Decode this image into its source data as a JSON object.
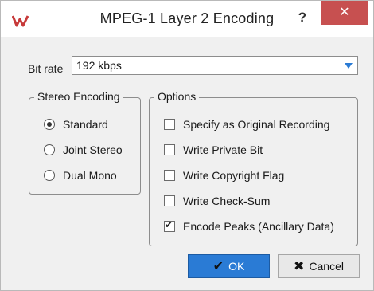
{
  "window": {
    "title": "MPEG-1 Layer 2 Encoding",
    "help_label": "?",
    "close_label": "✕",
    "app_icon": "app-icon"
  },
  "bitrate": {
    "label": "Bit rate",
    "value": "192 kbps"
  },
  "stereo": {
    "title": "Stereo Encoding",
    "options": [
      {
        "label": "Standard",
        "checked": true
      },
      {
        "label": "Joint Stereo",
        "checked": false
      },
      {
        "label": "Dual Mono",
        "checked": false
      }
    ]
  },
  "options": {
    "title": "Options",
    "items": [
      {
        "label": "Specify as Original Recording",
        "checked": false
      },
      {
        "label": "Write Private Bit",
        "checked": false
      },
      {
        "label": "Write Copyright Flag",
        "checked": false
      },
      {
        "label": "Write Check-Sum",
        "checked": false
      },
      {
        "label": "Encode Peaks (Ancillary Data)",
        "checked": true
      }
    ]
  },
  "buttons": {
    "ok_label": "OK",
    "ok_icon": "✔",
    "cancel_label": "Cancel",
    "cancel_icon": "✖"
  },
  "colors": {
    "accent": "#2a7bd5",
    "close": "#c75050"
  }
}
